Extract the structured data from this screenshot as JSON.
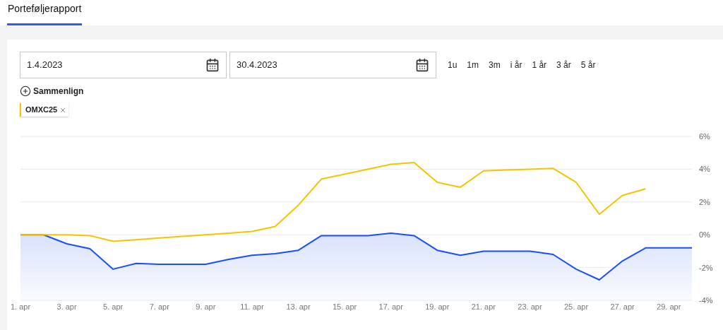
{
  "tabs": [
    {
      "label": "Porteføljerapport",
      "selected": true
    }
  ],
  "date_from": {
    "value": "1.4.2023"
  },
  "date_to": {
    "value": "30.4.2023"
  },
  "periods": [
    {
      "label": "1u"
    },
    {
      "label": "1m"
    },
    {
      "label": "3m"
    },
    {
      "label": "i år"
    },
    {
      "label": "1 år"
    },
    {
      "label": "3 år"
    },
    {
      "label": "5 år"
    }
  ],
  "compare": {
    "label": "Sammenlign"
  },
  "chips": [
    {
      "label": "OMXC25",
      "color": "#f5c400"
    }
  ],
  "chart_data": {
    "type": "line",
    "grid": true,
    "categories": [
      "1. apr",
      null,
      "3. apr",
      null,
      "5. apr",
      null,
      "7. apr",
      null,
      "9. apr",
      null,
      "11. apr",
      null,
      "13. apr",
      null,
      "15. apr",
      null,
      "17. apr",
      null,
      "19. apr",
      null,
      "21. apr",
      null,
      "23. apr",
      null,
      "25. apr",
      null,
      "27. apr",
      null,
      "29. apr",
      null
    ],
    "ylim": [
      -4,
      6
    ],
    "yticks": [
      {
        "value": 6,
        "label": "6%"
      },
      {
        "value": 4,
        "label": "4%"
      },
      {
        "value": 2,
        "label": "2%"
      },
      {
        "value": 0,
        "label": "0%"
      },
      {
        "value": -2,
        "label": "-2%"
      },
      {
        "value": -4,
        "label": "-4%"
      }
    ],
    "series": [
      {
        "color": "#1a4dff",
        "values": [
          0,
          0,
          -0.55,
          -0.85,
          -2.1,
          -1.75,
          -1.8,
          -1.8,
          -1.8,
          -1.5,
          -1.25,
          -1.15,
          -0.95,
          -0.05,
          -0.05,
          -0.05,
          0.1,
          -0.05,
          -0.95,
          -1.25,
          -1.0,
          -1.0,
          -1.0,
          -1.2,
          -2.1,
          -2.75,
          -1.6,
          -0.8,
          -0.8,
          -0.8
        ]
      },
      {
        "color": "#f5c400",
        "values": [
          0,
          0,
          0,
          -0.05,
          -0.4,
          -0.3,
          -0.2,
          -0.1,
          0,
          0.1,
          0.2,
          0.5,
          1.8,
          3.4,
          3.7,
          4.0,
          4.3,
          4.4,
          3.2,
          2.9,
          3.9,
          3.95,
          4.0,
          4.05,
          3.2,
          1.25,
          2.4,
          2.8,
          null,
          null
        ]
      }
    ]
  }
}
